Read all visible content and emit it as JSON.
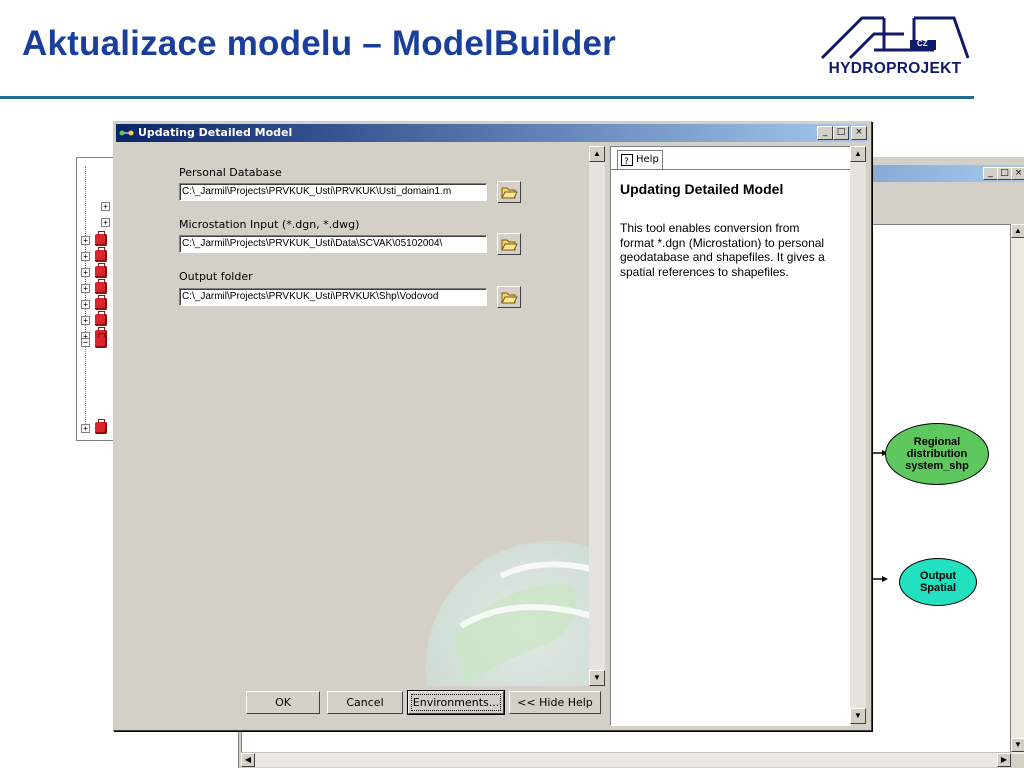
{
  "slide": {
    "title": "Aktualizace modelu – ModelBuilder",
    "logo_text": "HYDROPROJEKT",
    "logo_badge": "CZ"
  },
  "dialog": {
    "title": "Updating Detailed Model",
    "fields": [
      {
        "label": "Personal Database",
        "value": "C:\\_Jarmil\\Projects\\PRVKUK_Usti\\PRVKUK\\Usti_domain1.m"
      },
      {
        "label": "Microstation Input (*.dgn, *.dwg)",
        "value": "C:\\_Jarmil\\Projects\\PRVKUK_Usti\\Data\\SCVAK\\05102004\\"
      },
      {
        "label": "Output folder",
        "value": "C:\\_Jarmil\\Projects\\PRVKUK_Usti\\PRVKUK\\Shp\\Vodovod"
      }
    ],
    "buttons": {
      "ok": "OK",
      "cancel": "Cancel",
      "environments": "Environments...",
      "hide_help": "<< Hide Help"
    },
    "help": {
      "tab_label": "Help",
      "title": "Updating Detailed Model",
      "body": "This tool enables conversion from format *.dgn (Microstation) to personal geodatabase and shapefiles. It gives a spatial references to shapefiles."
    }
  },
  "model": {
    "nodes": [
      {
        "label": "Regional distribution system_shp",
        "color": "#5ec85e"
      },
      {
        "label": "Output Spatial",
        "color": "#22e0c0"
      }
    ]
  },
  "colors": {
    "title_blue": "#1a3e9c",
    "titlebar_start": "#0a246a",
    "titlebar_end": "#a6caf0",
    "dialog_face": "#d4d0c8"
  }
}
